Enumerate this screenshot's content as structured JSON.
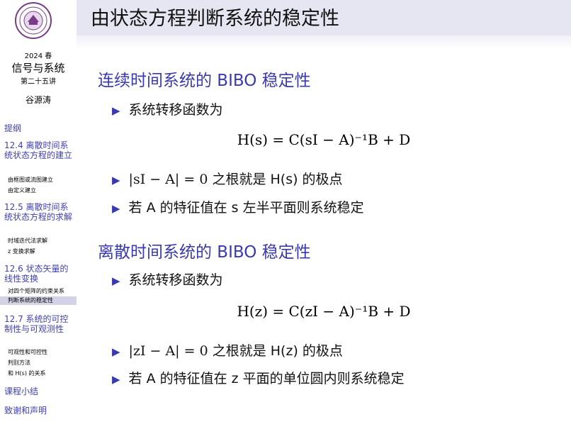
{
  "sidebar": {
    "year": "2024 春",
    "course": "信号与系统",
    "lecture": "第二十五讲",
    "author": "谷源涛",
    "nav": {
      "outline": "提纲",
      "sec1_title": "12.4 离散时间系统状态方程的建立",
      "sec1_sub1": "由框图或流图建立",
      "sec1_sub2": "由定义建立",
      "sec2_title": "12.5 离散时间系统状态方程的求解",
      "sec2_sub1": "时域迭代法求解",
      "sec2_sub2": "z 变换求解",
      "sec3_title": "12.6 状态矢量的线性变换",
      "sec3_sub1": "对四个矩阵的约束关系",
      "sec3_sub2": "判断系统的稳定性",
      "sec4_title": "12.7 系统的可控制性与可观测性",
      "sec4_sub1": "可观性和可控性",
      "sec4_sub2": "判别方法",
      "sec4_sub3": "和 H(s) 的关系",
      "summary": "课程小结",
      "thanks": "致谢和声明"
    }
  },
  "slide": {
    "title": "由状态方程判断系统的稳定性",
    "continuous": {
      "heading": "连续时间系统的 BIBO 稳定性",
      "b1": "系统转移函数为",
      "equation": "H(s) = C(sI − A)⁻¹B + D",
      "b2_text": "之根就是 H(s) 的极点",
      "b2_expr": "|sI − A| = 0",
      "b3_text": "若 A 的特征值在 s 左半平面则系统稳定"
    },
    "discrete": {
      "heading": "离散时间系统的 BIBO 稳定性",
      "b1": "系统转移函数为",
      "equation": "H(z) = C(zI − A)⁻¹B + D",
      "b2_text": "之根就是 H(z) 的极点",
      "b2_expr": "|zI − A| = 0",
      "b3_text": "若 A 的特征值在 z 平面的单位圆内则系统稳定"
    }
  },
  "colors": {
    "accent": "#3a3ab0",
    "nav": "#4040b0",
    "titlebar": "#e6e6f2",
    "active_nav": "#d3d3e8"
  }
}
